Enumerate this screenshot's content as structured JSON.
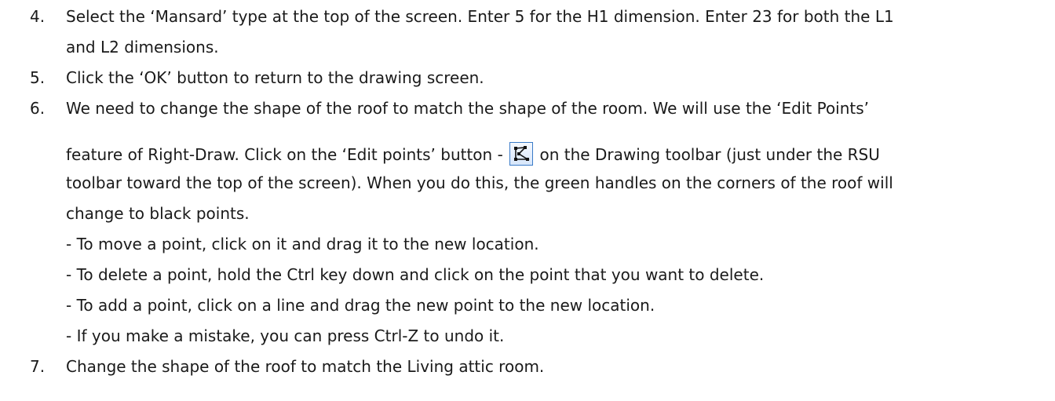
{
  "steps": [
    {
      "number": "4.",
      "lines": [
        "Select the ‘Mansard’ type at the top of the screen.  Enter 5 for the H1 dimension.  Enter 23 for both the L1",
        "and L2 dimensions."
      ]
    },
    {
      "number": "5.",
      "lines": [
        "Click the ‘OK’ button to return to the drawing screen."
      ]
    },
    {
      "number": "6.",
      "lines": [
        "We need to change the shape of the roof to match the shape of the room.  We will use the ‘Edit Points’",
        "feature of Right-Draw.  Click on the ‘Edit points’ button -",
        "on the Drawing toolbar (just under the RSU",
        "toolbar toward the top of the screen).  When you do this, the green handles on the corners of the roof will",
        "change to black points."
      ],
      "bullets": [
        "- To move a point, click on it and drag it to the new location.",
        "- To delete a point, hold the Ctrl key down and click on the point that you want to delete.",
        "- To add a point, click on a line and drag the new point to the new location.",
        "- If you make a mistake, you can press Ctrl-Z to undo it."
      ],
      "icon": "edit-points-icon"
    },
    {
      "number": "7.",
      "lines": [
        "Change the shape of the roof to match the Living attic room."
      ]
    }
  ],
  "colors": {
    "text": "#1a1a1a",
    "icon_border": "#3a7bc8"
  }
}
